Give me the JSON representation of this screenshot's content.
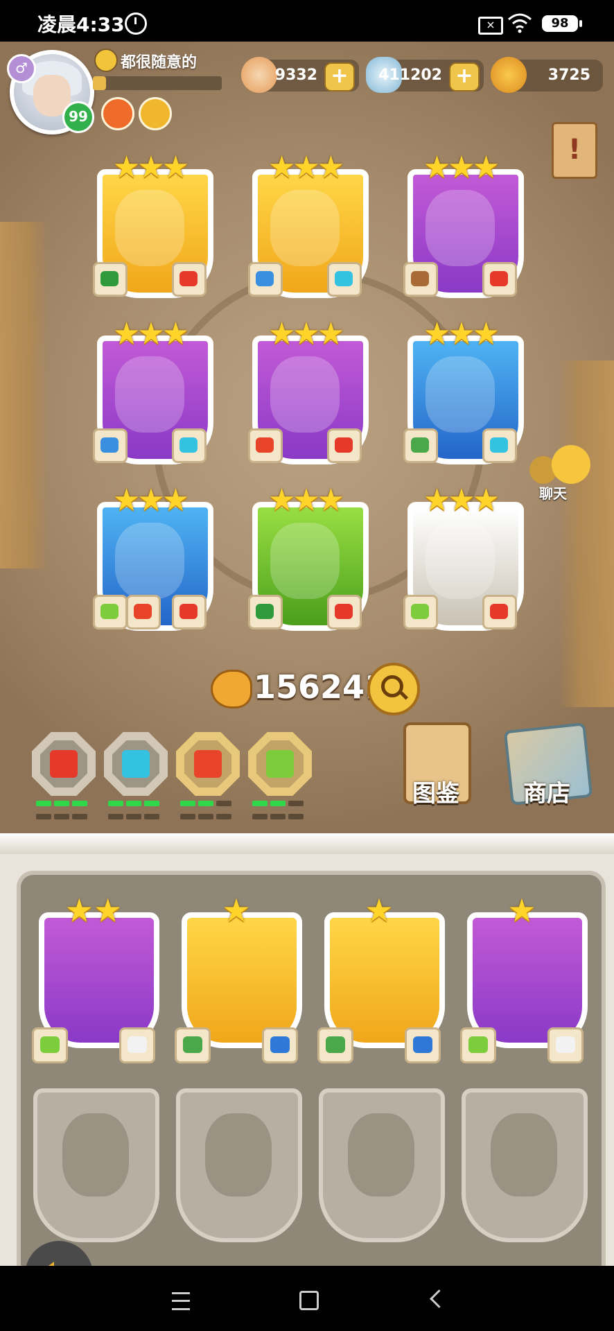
{
  "status_bar": {
    "time": "凌晨4:33",
    "battery": "98"
  },
  "player": {
    "name": "都很随意的",
    "level": "99",
    "xp_fraction": 0.1,
    "gender_glyph": "♂"
  },
  "currencies": {
    "meat": "9332",
    "gems": "411202",
    "coins": "3725",
    "plus_glyph": "+"
  },
  "team_cards": [
    {
      "stars": "★★★",
      "rarity": "gold",
      "elements": [
        "forest",
        "fire"
      ]
    },
    {
      "stars": "★★★",
      "rarity": "gold",
      "elements": [
        "water",
        "wind"
      ]
    },
    {
      "stars": "★★★",
      "rarity": "purple",
      "elements": [
        "earth",
        "fire"
      ]
    },
    {
      "stars": "★★★",
      "rarity": "purple",
      "elements": [
        "water",
        "wind"
      ]
    },
    {
      "stars": "★★★",
      "rarity": "purple",
      "elements": [
        "volcano",
        "fire"
      ]
    },
    {
      "stars": "★★★",
      "rarity": "blue",
      "elements": [
        "grass-beast",
        "wind"
      ]
    },
    {
      "stars": "★★★",
      "rarity": "blue",
      "elements": [
        "plains",
        "volcano",
        "fire"
      ]
    },
    {
      "stars": "★★★",
      "rarity": "green",
      "elements": [
        "forest",
        "fire"
      ]
    },
    {
      "stars": "★★★",
      "rarity": "white",
      "elements": [
        "plains",
        "fire"
      ]
    }
  ],
  "power": {
    "value": "156241"
  },
  "filters": [
    {
      "element": "fire",
      "pips_on": 3
    },
    {
      "element": "wind",
      "pips_on": 3
    },
    {
      "element": "volcano",
      "pips_on": 2
    },
    {
      "element": "plains",
      "pips_on": 2
    }
  ],
  "buttons": {
    "dex": "图鉴",
    "shop": "商店",
    "chat": "聊天"
  },
  "bench_cards": [
    {
      "stars": "★★",
      "rarity": "purple",
      "elements": [
        "plains",
        "cloud"
      ]
    },
    {
      "stars": "★",
      "rarity": "gold",
      "elements": [
        "grass-beast",
        "tornado"
      ]
    },
    {
      "stars": "★",
      "rarity": "gold",
      "elements": [
        "grass-beast",
        "tornado"
      ]
    },
    {
      "stars": "★",
      "rarity": "purple",
      "elements": [
        "plains",
        "cloud"
      ]
    }
  ],
  "colors": {
    "fire": "#e53a2a",
    "wind": "#33c3e0",
    "volcano": "#e8442a",
    "plains": "#7ccc3c",
    "forest": "#2f9a3a",
    "water": "#3a8fe0",
    "earth": "#a86a36",
    "grass-beast": "#4aa84a",
    "cloud": "#f2f2f2",
    "tornado": "#2f78d8"
  }
}
